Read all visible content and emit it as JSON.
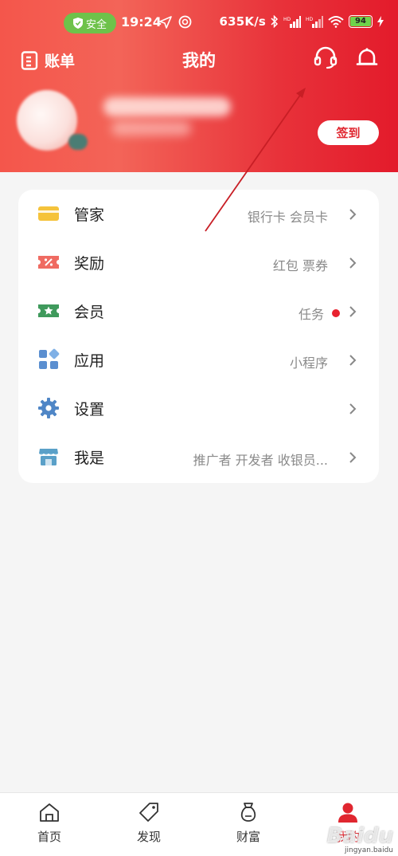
{
  "status_bar": {
    "safe_label": "安全",
    "time": "19:24",
    "network_speed": "635K/s",
    "battery_level": "94"
  },
  "header": {
    "bill_label": "账单",
    "title": "我的",
    "signin_label": "签到"
  },
  "menu": [
    {
      "title": "管家",
      "subtitle": "银行卡 会员卡",
      "icon": "card-icon",
      "color": "#f5c33b",
      "dot": false
    },
    {
      "title": "奖励",
      "subtitle": "红包 票券",
      "icon": "coupon-icon",
      "color": "#ef6b62",
      "dot": false
    },
    {
      "title": "会员",
      "subtitle": "任务",
      "icon": "member-star-icon",
      "color": "#3f9a5c",
      "dot": true
    },
    {
      "title": "应用",
      "subtitle": "小程序",
      "icon": "apps-grid-icon",
      "color": "#5b8fd0",
      "dot": false
    },
    {
      "title": "设置",
      "subtitle": "",
      "icon": "gear-icon",
      "color": "#4f86c6",
      "dot": false
    },
    {
      "title": "我是",
      "subtitle": "推广者 开发者 收银员...",
      "icon": "store-icon",
      "color": "#5aa0c8",
      "dot": false
    }
  ],
  "tabs": [
    {
      "label": "首页",
      "icon": "home-icon",
      "active": false
    },
    {
      "label": "发现",
      "icon": "tag-icon",
      "active": false
    },
    {
      "label": "财富",
      "icon": "money-bag-icon",
      "active": false
    },
    {
      "label": "我的",
      "icon": "person-icon",
      "active": true
    }
  ],
  "watermark": {
    "brand": "Baidu",
    "site": "jingyan.baidu"
  },
  "colors": {
    "header_red": "#e31b2b",
    "accent_red": "#e0262f",
    "status_pill_green": "#6ec24a"
  }
}
